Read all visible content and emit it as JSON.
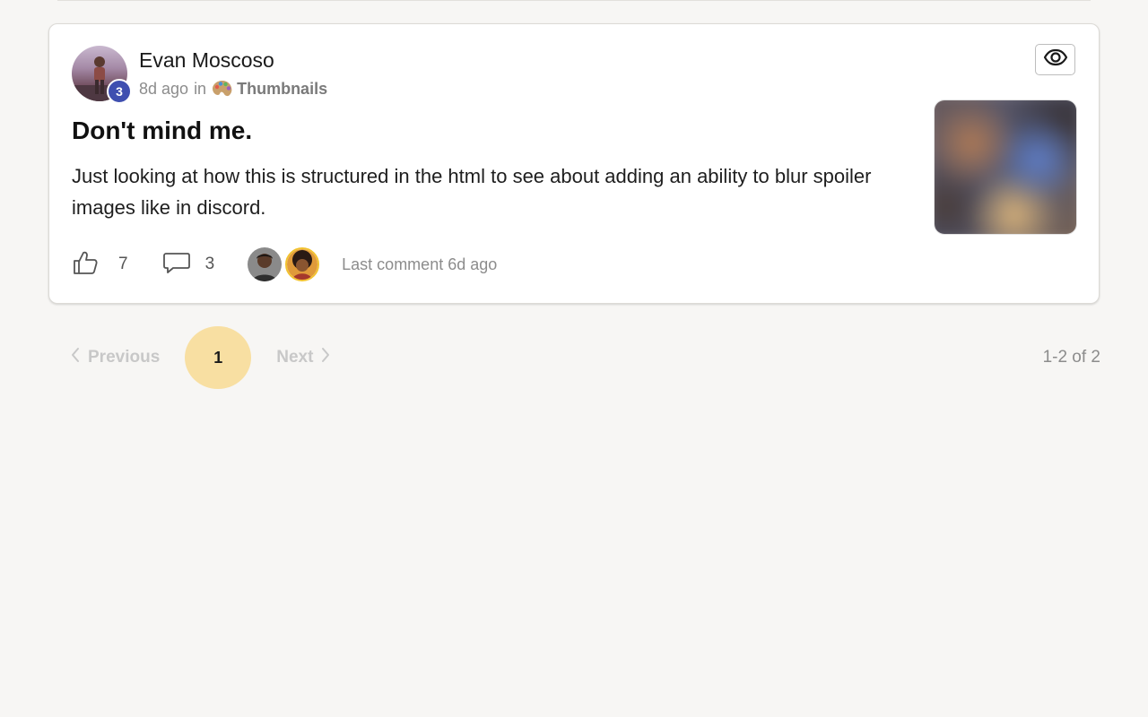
{
  "post": {
    "author": {
      "name": "Evan Moscoso",
      "rank": "3",
      "rank_color": "#3f4fb0"
    },
    "meta": {
      "time_ago": "8d ago",
      "in_label": "in",
      "category_icon": "palette-icon",
      "category": "Thumbnails"
    },
    "title": "Don't mind me.",
    "body": "Just looking at how this is structured in the html to see about adding an ability to blur spoiler images like in discord.",
    "visibility_icon": "eye-icon",
    "thumbnail_state": "blurred",
    "likes": "7",
    "like_icon": "thumbs-up-icon",
    "comments": "3",
    "comment_icon": "comment-bubble-icon",
    "last_comment": "Last comment 6d ago"
  },
  "pagination": {
    "previous_label": "Previous",
    "current_page": "1",
    "next_label": "Next",
    "range": "1-2 of 2",
    "accent_color": "#f8dfa2"
  }
}
